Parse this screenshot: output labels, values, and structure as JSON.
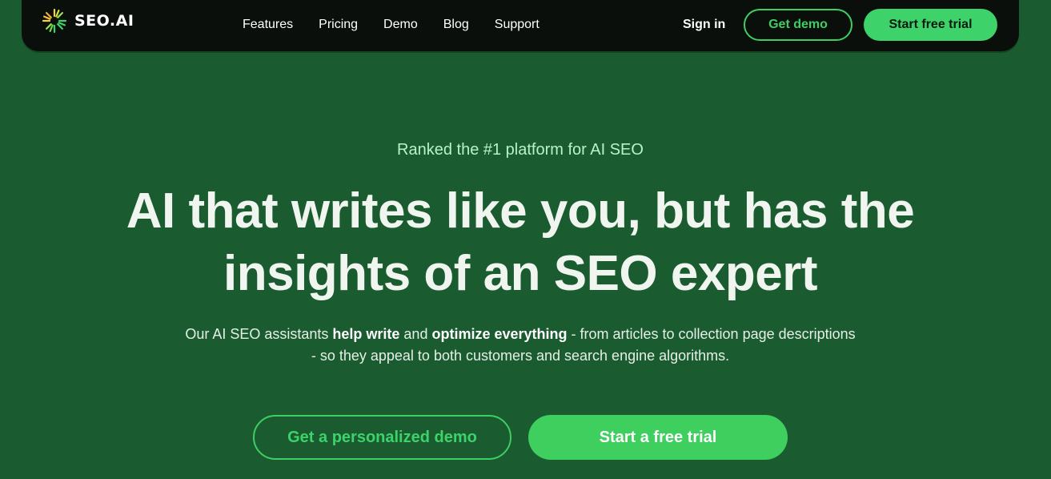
{
  "colors": {
    "page_background": "#1a5c30",
    "navbar_background": "#0b0f0c",
    "accent_green": "#3ed26a",
    "eyebrow_text": "#b8f2c6",
    "headline_text": "#f1f5ef"
  },
  "header": {
    "logo_icon": "sunburst-logo-icon",
    "logo_text": "SEO.AI",
    "nav": [
      {
        "label": "Features"
      },
      {
        "label": "Pricing"
      },
      {
        "label": "Demo"
      },
      {
        "label": "Blog"
      },
      {
        "label": "Support"
      }
    ],
    "sign_in_label": "Sign in",
    "get_demo_label": "Get demo",
    "start_trial_label": "Start free trial"
  },
  "hero": {
    "eyebrow": "Ranked the #1 platform for AI SEO",
    "headline": "AI that writes like you, but has the insights of an SEO expert",
    "subtext": {
      "part1": "Our AI SEO assistants ",
      "bold1": "help write",
      "part2": " and ",
      "bold2": "optimize everything",
      "part3": " - from articles to collection page descriptions - so they appeal to both customers and search engine algorithms."
    },
    "demo_button_label": "Get a personalized demo",
    "trial_button_label": "Start a free trial"
  }
}
